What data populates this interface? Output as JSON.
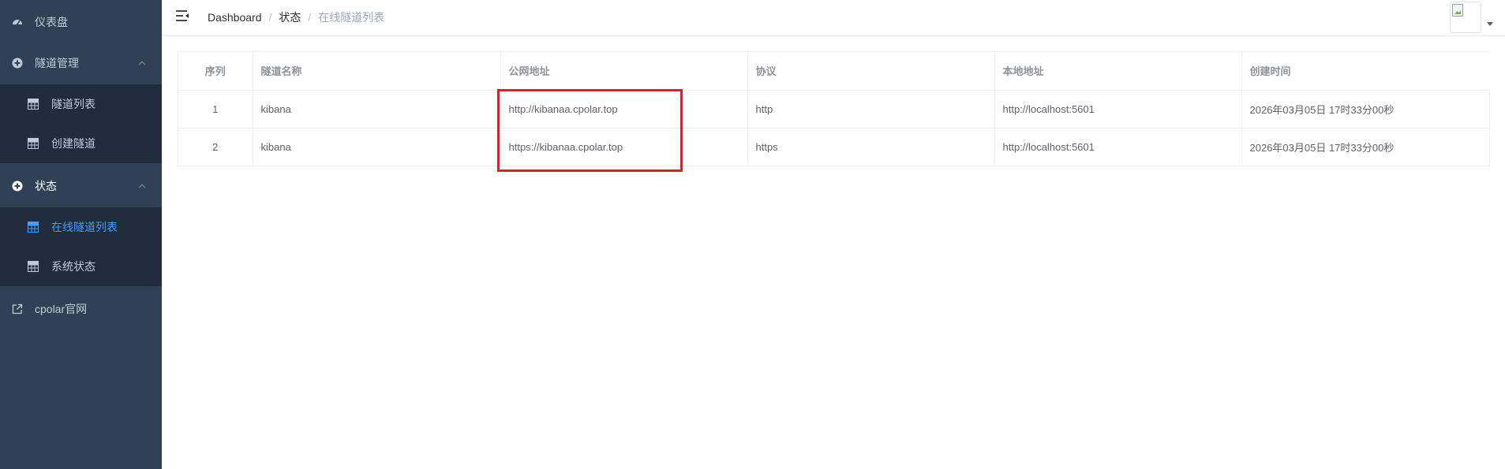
{
  "sidebar": {
    "items": [
      {
        "label": "仪表盘",
        "icon": "dashboard-icon"
      },
      {
        "label": "隧道管理",
        "icon": "plus-circle-icon",
        "expanded": true,
        "children": [
          {
            "label": "隧道列表",
            "icon": "grid-icon"
          },
          {
            "label": "创建隧道",
            "icon": "grid-icon"
          }
        ]
      },
      {
        "label": "状态",
        "icon": "plus-circle-icon",
        "expanded": true,
        "children": [
          {
            "label": "在线隧道列表",
            "icon": "grid-icon",
            "active": true
          },
          {
            "label": "系统状态",
            "icon": "grid-icon"
          }
        ]
      },
      {
        "label": "cpolar官网",
        "icon": "external-link-icon"
      }
    ]
  },
  "header": {
    "breadcrumb": [
      "Dashboard",
      "状态",
      "在线隧道列表"
    ],
    "separator": "/"
  },
  "table": {
    "columns": [
      "序列",
      "隧道名称",
      "公网地址",
      "协议",
      "本地地址",
      "创建时间"
    ],
    "rows": [
      [
        "1",
        "kibana",
        "http://kibanaa.cpolar.top",
        "http",
        "http://localhost:5601",
        "2026年03月05日 17时33分00秒"
      ],
      [
        "2",
        "kibana",
        "https://kibanaa.cpolar.top",
        "https",
        "http://localhost:5601",
        "2026年03月05日 17时33分00秒"
      ]
    ]
  },
  "colors": {
    "sidebar_bg": "#304156",
    "submenu_bg": "#1f2d3d",
    "active": "#409eff",
    "highlight": "#e02020"
  }
}
